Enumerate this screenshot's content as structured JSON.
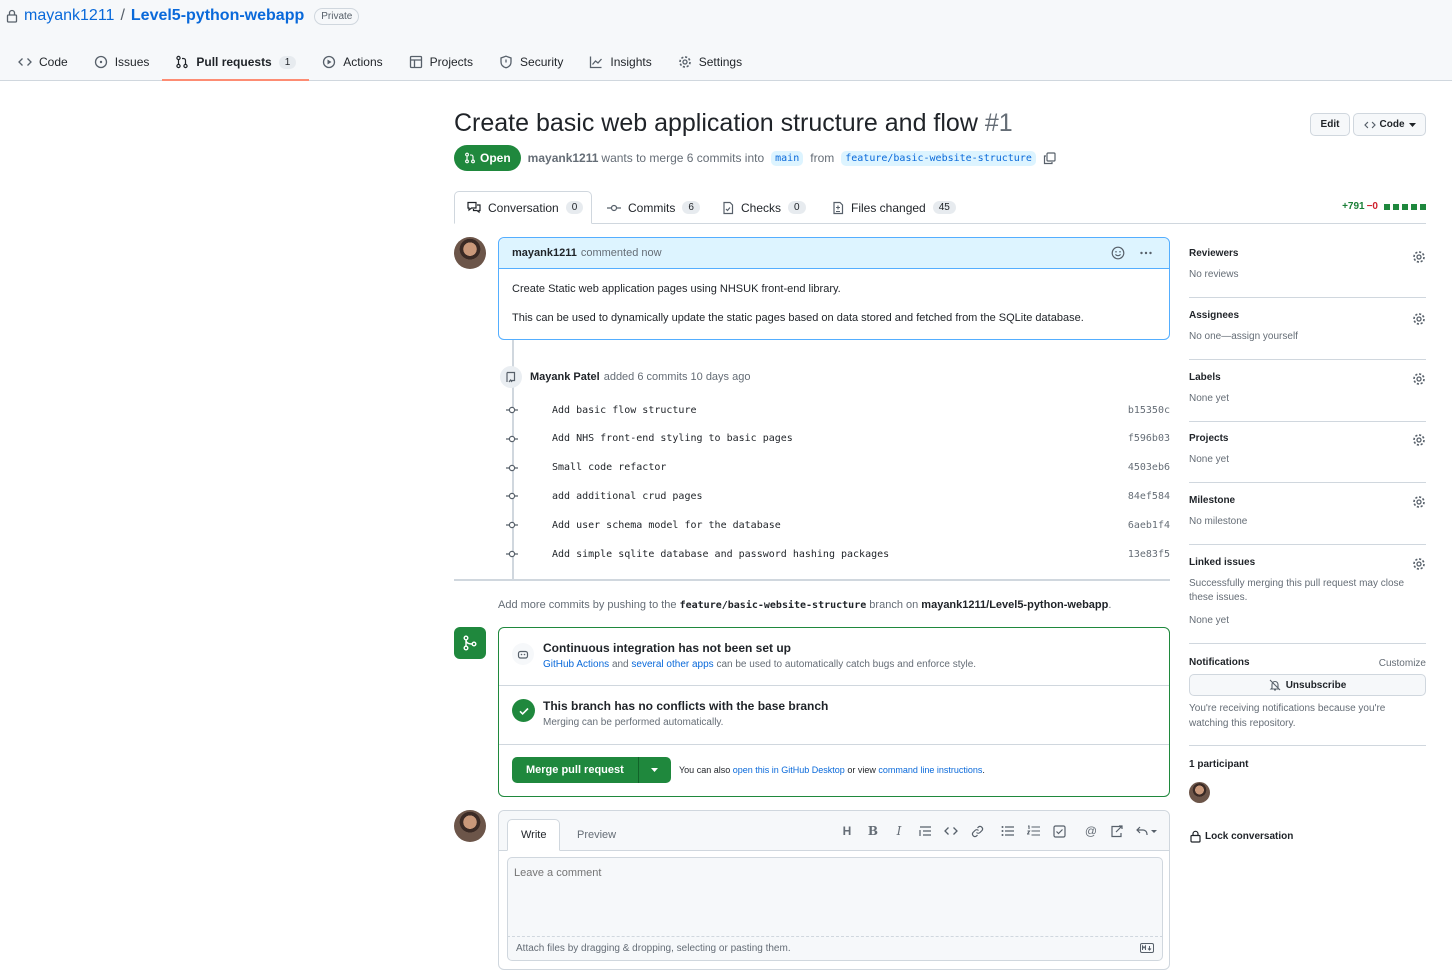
{
  "repo": {
    "owner": "mayank1211",
    "separator": "/",
    "name": "Level5-python-webapp",
    "visibility": "Private"
  },
  "nav": [
    {
      "label": "Code",
      "icon": "code-icon"
    },
    {
      "label": "Issues",
      "icon": "issue-icon"
    },
    {
      "label": "Pull requests",
      "icon": "pull-request-icon",
      "count": "1",
      "active": true
    },
    {
      "label": "Actions",
      "icon": "play-icon"
    },
    {
      "label": "Projects",
      "icon": "table-icon"
    },
    {
      "label": "Security",
      "icon": "shield-icon"
    },
    {
      "label": "Insights",
      "icon": "graph-icon"
    },
    {
      "label": "Settings",
      "icon": "gear-icon"
    }
  ],
  "pr": {
    "title": "Create basic web application structure and flow",
    "number": "#1",
    "state": "Open",
    "author": "mayank1211",
    "merge_text": "wants to merge 6 commits into",
    "base": "main",
    "from_text": "from",
    "head": "feature/basic-website-structure",
    "edit_label": "Edit",
    "code_label": "Code"
  },
  "tabs": [
    {
      "label": "Conversation",
      "count": "0"
    },
    {
      "label": "Commits",
      "count": "6"
    },
    {
      "label": "Checks",
      "count": "0"
    },
    {
      "label": "Files changed",
      "count": "45"
    }
  ],
  "diffstat": {
    "additions": "+791",
    "deletions": "−0"
  },
  "comment": {
    "author": "mayank1211",
    "meta": "commented now",
    "paragraphs": [
      "Create Static web application pages using NHSUK front-end library.",
      "This can be used to dynamically update the static pages based on data stored and fetched from the SQLite database."
    ]
  },
  "commits_event": {
    "author": "Mayank Patel",
    "text": "added 6 commits 10 days ago"
  },
  "commits": [
    {
      "message": "Add basic flow structure",
      "sha": "b15350c"
    },
    {
      "message": "Add NHS front-end styling to basic pages",
      "sha": "f596b03"
    },
    {
      "message": "Small code refactor",
      "sha": "4503eb6"
    },
    {
      "message": "add additional crud pages",
      "sha": "84ef584"
    },
    {
      "message": "Add user schema model for the database",
      "sha": "6aeb1f4"
    },
    {
      "message": "Add simple sqlite database and password hashing packages",
      "sha": "13e83f5"
    }
  ],
  "push_note": {
    "pre": "Add more commits by pushing to the",
    "branch": "feature/basic-website-structure",
    "mid": "branch on",
    "repo": "mayank1211/Level5-python-webapp",
    "end": "."
  },
  "merge": {
    "ci_title": "Continuous integration has not been set up",
    "ci_link1": "GitHub Actions",
    "ci_and": "and",
    "ci_link2": "several other apps",
    "ci_rest": "can be used to automatically catch bugs and enforce style.",
    "conflict_title": "This branch has no conflicts with the base branch",
    "conflict_sub": "Merging can be performed automatically.",
    "button": "Merge pull request",
    "also_pre": "You can also",
    "also_link1": "open this in GitHub Desktop",
    "also_mid": "or view",
    "also_link2": "command line instructions",
    "also_end": "."
  },
  "form": {
    "write_tab": "Write",
    "preview_tab": "Preview",
    "placeholder": "Leave a comment",
    "attach": "Attach files by dragging & dropping, selecting or pasting them."
  },
  "sidebar": {
    "reviewers": {
      "title": "Reviewers",
      "value": "No reviews"
    },
    "assignees": {
      "title": "Assignees",
      "value": "No one—assign yourself"
    },
    "labels": {
      "title": "Labels",
      "value": "None yet"
    },
    "projects": {
      "title": "Projects",
      "value": "None yet"
    },
    "milestone": {
      "title": "Milestone",
      "value": "No milestone"
    },
    "linked": {
      "title": "Linked issues",
      "desc": "Successfully merging this pull request may close these issues.",
      "value": "None yet"
    },
    "notifications": {
      "title": "Notifications",
      "customize": "Customize",
      "button": "Unsubscribe",
      "note": "You're receiving notifications because you're watching this repository."
    },
    "participants": {
      "title": "1 participant"
    },
    "lock": "Lock conversation"
  },
  "colors": {
    "green": "#1f883d",
    "blue": "#0969da",
    "border": "#d0d7de",
    "active_tab": "#fd8c73"
  }
}
